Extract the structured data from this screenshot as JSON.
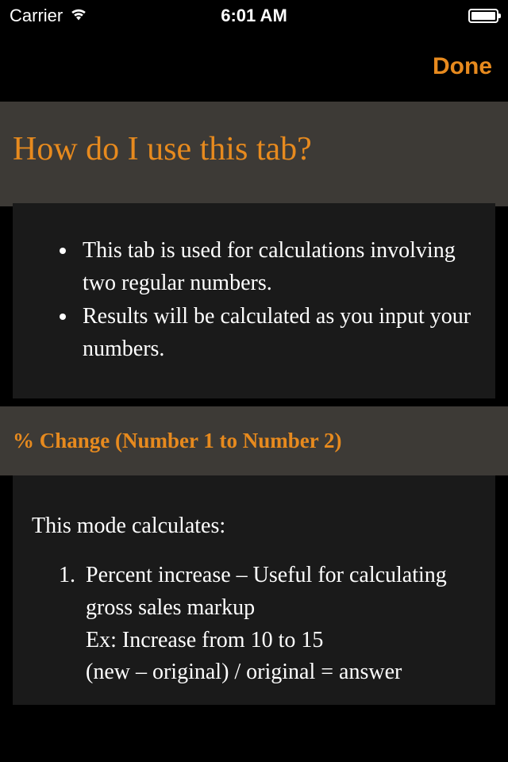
{
  "status": {
    "carrier": "Carrier",
    "time": "6:01 AM"
  },
  "nav": {
    "done": "Done"
  },
  "section1": {
    "title": "How do I use this tab?",
    "bullets": [
      "This tab is used for calculations involving two regular numbers.",
      "Results will be calculated as you input your numbers."
    ]
  },
  "section2": {
    "title": "% Change (Number 1 to Number 2)",
    "intro": "This mode calculates:",
    "items": [
      "Percent increase – Useful for calculating gross sales markup\nEx: Increase from 10 to 15\n(new – original) / original = answer"
    ]
  }
}
